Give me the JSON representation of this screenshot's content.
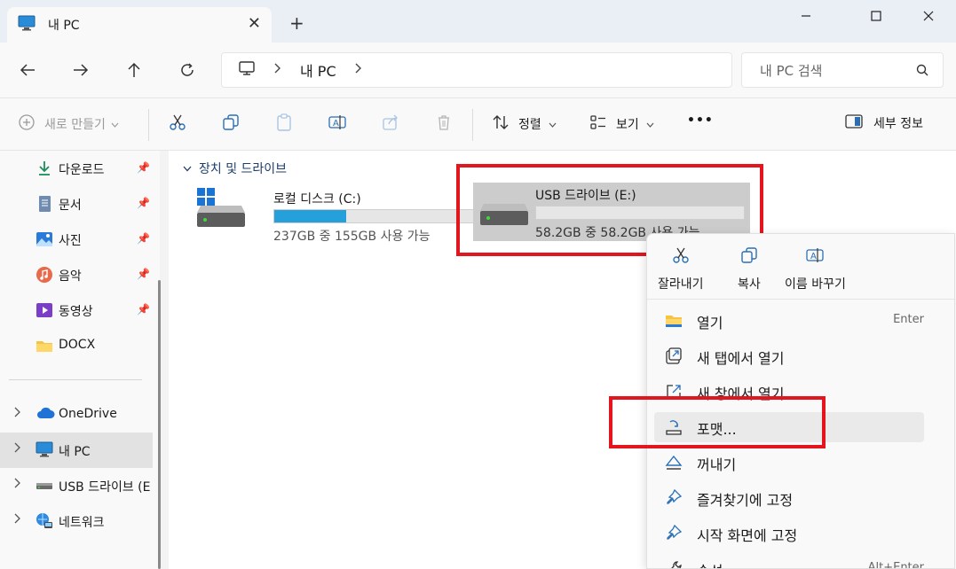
{
  "window": {
    "tab_title": "내 PC",
    "tab_close": "✕",
    "new_tab": "+"
  },
  "nav": {
    "breadcrumb": "내 PC",
    "search_placeholder": "내 PC 검색"
  },
  "commands": {
    "new": "새로 만들기",
    "sort": "정렬",
    "view": "보기",
    "more": "•••",
    "details": "세부 정보"
  },
  "sidebar": {
    "quick": [
      {
        "label": "다운로드",
        "icon": "download-icon"
      },
      {
        "label": "문서",
        "icon": "document-icon"
      },
      {
        "label": "사진",
        "icon": "pictures-icon"
      },
      {
        "label": "음악",
        "icon": "music-icon"
      },
      {
        "label": "동영상",
        "icon": "video-icon"
      },
      {
        "label": "DOCX",
        "icon": "folder-icon"
      }
    ],
    "tree": [
      {
        "label": "OneDrive",
        "icon": "cloud-icon"
      },
      {
        "label": "내 PC",
        "icon": "pc-icon"
      },
      {
        "label": "USB 드라이브 (E",
        "icon": "usb-drive-icon"
      },
      {
        "label": "네트워크",
        "icon": "network-icon"
      }
    ]
  },
  "content": {
    "group_title": "장치 및 드라이브",
    "drives": [
      {
        "name": "로컬 디스크 (C:)",
        "usage": "237GB 중 155GB 사용 가능",
        "used_fraction": 0.346
      },
      {
        "name": "USB 드라이브 (E:)",
        "usage": "58.2GB 중 58.2GB 사용 가능",
        "used_fraction": 0.0
      }
    ]
  },
  "context_menu": {
    "quick_actions": [
      {
        "label": "잘라내기",
        "icon": "cut-icon"
      },
      {
        "label": "복사",
        "icon": "copy-icon"
      },
      {
        "label": "이름 바꾸기",
        "icon": "rename-icon"
      }
    ],
    "items": [
      {
        "label": "열기",
        "shortcut": "Enter",
        "icon": "folder-open-icon"
      },
      {
        "label": "새 탭에서 열기",
        "shortcut": "",
        "icon": "new-tab-icon"
      },
      {
        "label": "새 창에서 열기",
        "shortcut": "",
        "icon": "new-window-icon"
      },
      {
        "label": "포맷...",
        "shortcut": "",
        "icon": "format-icon"
      },
      {
        "label": "꺼내기",
        "shortcut": "",
        "icon": "eject-icon"
      },
      {
        "label": "즐겨찾기에 고정",
        "shortcut": "",
        "icon": "pin-icon"
      },
      {
        "label": "시작 화면에 고정",
        "shortcut": "",
        "icon": "pin-start-icon"
      },
      {
        "label": "속성",
        "shortcut": "Alt+Enter",
        "icon": "properties-icon"
      }
    ]
  },
  "colors": {
    "accent": "#26a0da",
    "highlight": "#e3151f",
    "selected": "#cccccc"
  }
}
